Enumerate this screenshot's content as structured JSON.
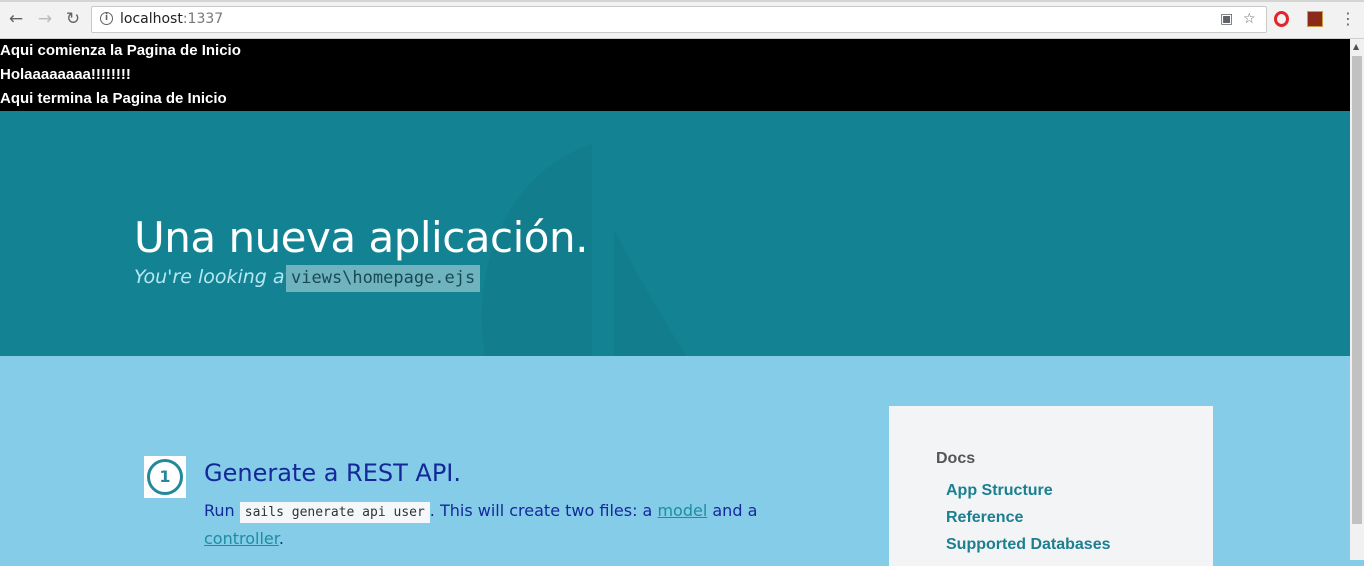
{
  "browser": {
    "url_host": "localhost",
    "url_port": ":1337",
    "icons": {
      "back": "back-arrow-icon",
      "forward": "forward-arrow-icon",
      "reload": "reload-icon",
      "info": "info-icon",
      "translate": "translate-icon",
      "bookmark": "star-icon",
      "opera": "opera-extension-icon",
      "extension": "extension-icon",
      "menu": "kebab-menu-icon"
    }
  },
  "header_lines": [
    "Aqui comienza la Pagina de Inicio",
    "Holaaaaaaaa!!!!!!!!",
    "Aqui termina la Pagina de Inicio"
  ],
  "hero": {
    "title": "Una nueva aplicación.",
    "subtitle": "You're looking at:",
    "file": "views\\homepage.ejs"
  },
  "step1": {
    "number": "1",
    "title": "Generate a REST API.",
    "text_run": "Run",
    "command": "sails generate api user",
    "text_create": ". This will create two files: a",
    "link_model": "model",
    "text_and": "and a",
    "link_controller": "controller",
    "text_end": "."
  },
  "docs": {
    "heading": "Docs",
    "links": [
      "App Structure",
      "Reference",
      "Supported Databases"
    ]
  },
  "colors": {
    "hero_bg": "#138394",
    "page_bg": "#85cce9",
    "step_text": "#14289a",
    "link": "#1c8ea1"
  }
}
